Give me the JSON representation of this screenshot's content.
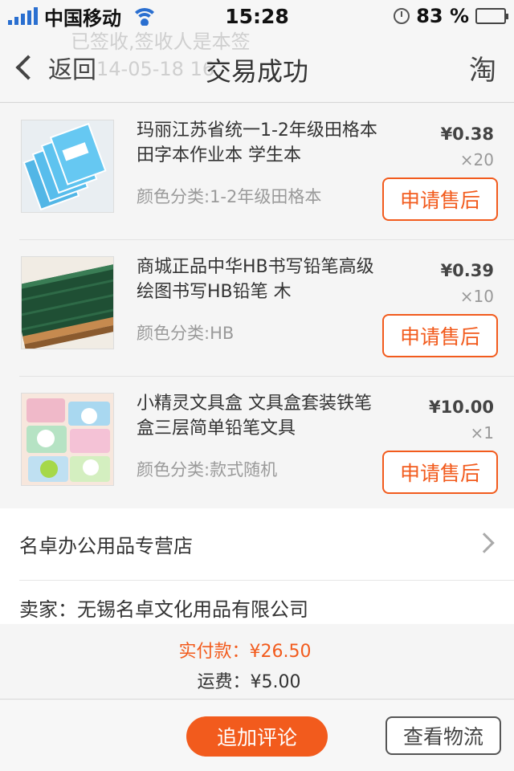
{
  "status_bar": {
    "carrier": "中国移动",
    "time": "15:28",
    "battery": "83 %",
    "battery_level": 0.83
  },
  "navbar": {
    "back_label": "返回",
    "title": "交易成功",
    "right_icon_label": "淘",
    "ghost_line_1": "已签收,签收人是本签",
    "ghost_line_2": "14-05-18 16"
  },
  "items": [
    {
      "title": "玛丽江苏省统一1-2年级田格本 田字本作业本 学生本",
      "variant": "颜色分类:1-2年级田格本",
      "price": "¥0.38",
      "qty": "×20",
      "button": "申请售后"
    },
    {
      "title": "商城正品中华HB书写铅笔高级绘图书写HB铅笔 木",
      "variant": "颜色分类:HB",
      "price": "¥0.39",
      "qty": "×10",
      "button": "申请售后"
    },
    {
      "title": "小精灵文具盒 文具盒套装铁笔盒三层简单铅笔文具",
      "variant": "颜色分类:款式随机",
      "price": "¥10.00",
      "qty": "×1",
      "button": "申请售后"
    }
  ],
  "shop": {
    "name": "名卓办公用品专营店",
    "seller": "卖家：无锡名卓文化用品有限公司"
  },
  "totals": {
    "paid": "实付款：¥26.50",
    "freight": "运费：¥5.00"
  },
  "actions": {
    "review": "追加评论",
    "logistics": "查看物流"
  },
  "colors": {
    "accent": "#f25b1d",
    "signal": "#2a6fd0",
    "battery": "#3ac43a"
  }
}
